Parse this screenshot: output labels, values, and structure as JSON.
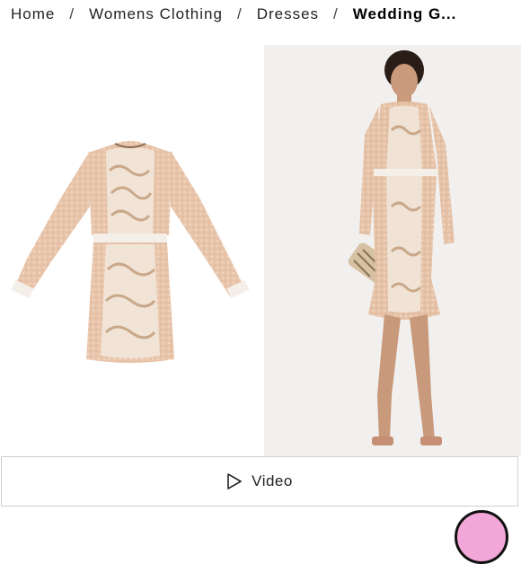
{
  "breadcrumb": {
    "items": [
      "Home",
      "Womens Clothing",
      "Dresses"
    ],
    "current": "Wedding G...",
    "separator": "/"
  },
  "gallery": {
    "images": [
      {
        "alt": "Dress flat lay"
      },
      {
        "alt": "Model wearing dress"
      }
    ]
  },
  "video_button": {
    "label": "Video",
    "icon": "play-icon"
  },
  "colors": {
    "dress": "#e8c7ad",
    "lace": "#f4efe8",
    "border": "#cfcfcf",
    "badge": "#f3a6d8"
  }
}
